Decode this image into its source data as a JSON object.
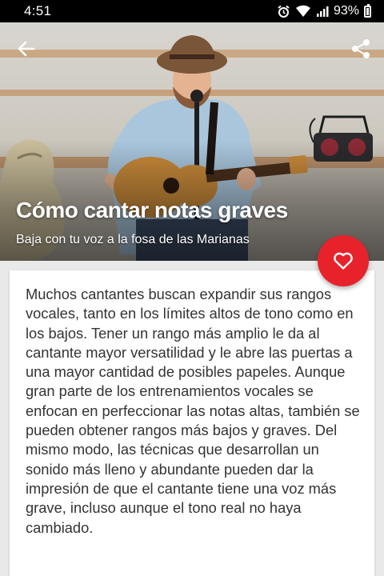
{
  "status_bar": {
    "time": "4:51",
    "battery": "93%",
    "icons": [
      "alarm-icon",
      "wifi-icon",
      "signal-icon",
      "battery-icon"
    ]
  },
  "header": {
    "title": "Cómo cantar notas graves",
    "subtitle": "Baja con tu voz a la fosa de las Marianas",
    "back_icon": "back-arrow-icon",
    "share_icon": "share-icon"
  },
  "favorite": {
    "icon": "heart-outline-icon",
    "color": "#e8222a"
  },
  "article": {
    "body": "Muchos cantantes buscan expandir sus rangos vocales, tanto en los límites altos de tono como en los bajos. Tener un rango más amplio le da al cantante mayor versatilidad y le abre las puertas a una mayor cantidad de posibles papeles. Aunque gran parte de los entrenamientos vocales se enfocan en perfeccionar las notas altas, también se pueden obtener rangos más bajos y graves. Del mismo modo, las técnicas que desarrollan un sonido más lleno y abundante pueden dar la impresión de que el cantante tiene una voz más grave, incluso aunque el tono real no haya cambiado."
  }
}
